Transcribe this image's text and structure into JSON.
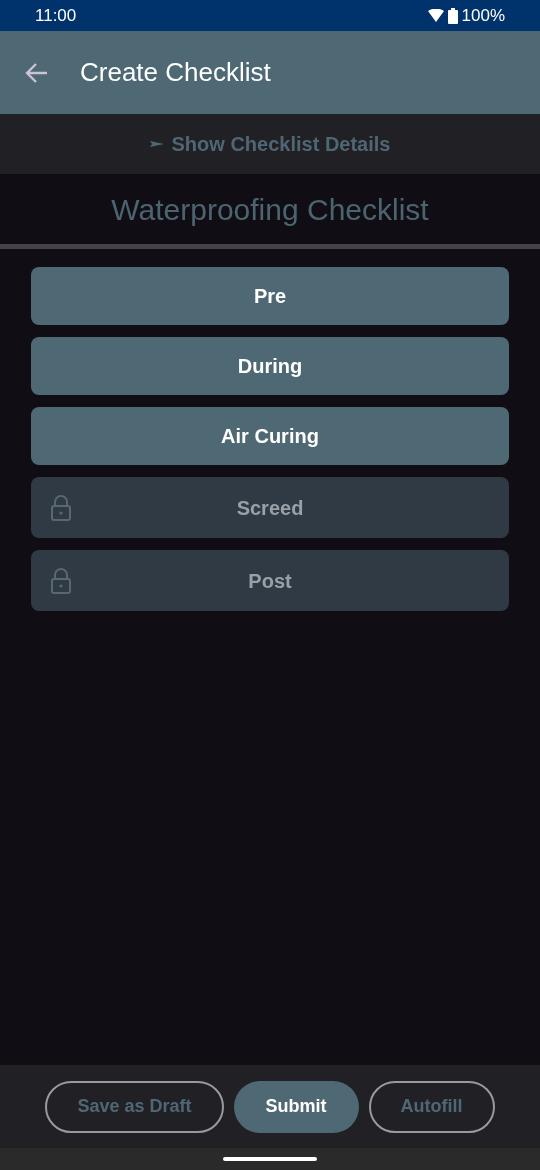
{
  "status_bar": {
    "time": "11:00",
    "battery": "100%"
  },
  "app_bar": {
    "title": "Create Checklist"
  },
  "details_toggle": {
    "label": "Show Checklist Details",
    "expanded": false
  },
  "checklist_title": "Waterproofing Checklist",
  "sections": [
    {
      "label": "Pre",
      "locked": false
    },
    {
      "label": "During",
      "locked": false
    },
    {
      "label": "Air Curing",
      "locked": false
    },
    {
      "label": "Screed",
      "locked": true
    },
    {
      "label": "Post",
      "locked": true
    }
  ],
  "actions": [
    {
      "label": "Save as Draft",
      "kind": "outlined"
    },
    {
      "label": "Submit",
      "kind": "filled"
    },
    {
      "label": "Autofill",
      "kind": "outlined"
    }
  ]
}
